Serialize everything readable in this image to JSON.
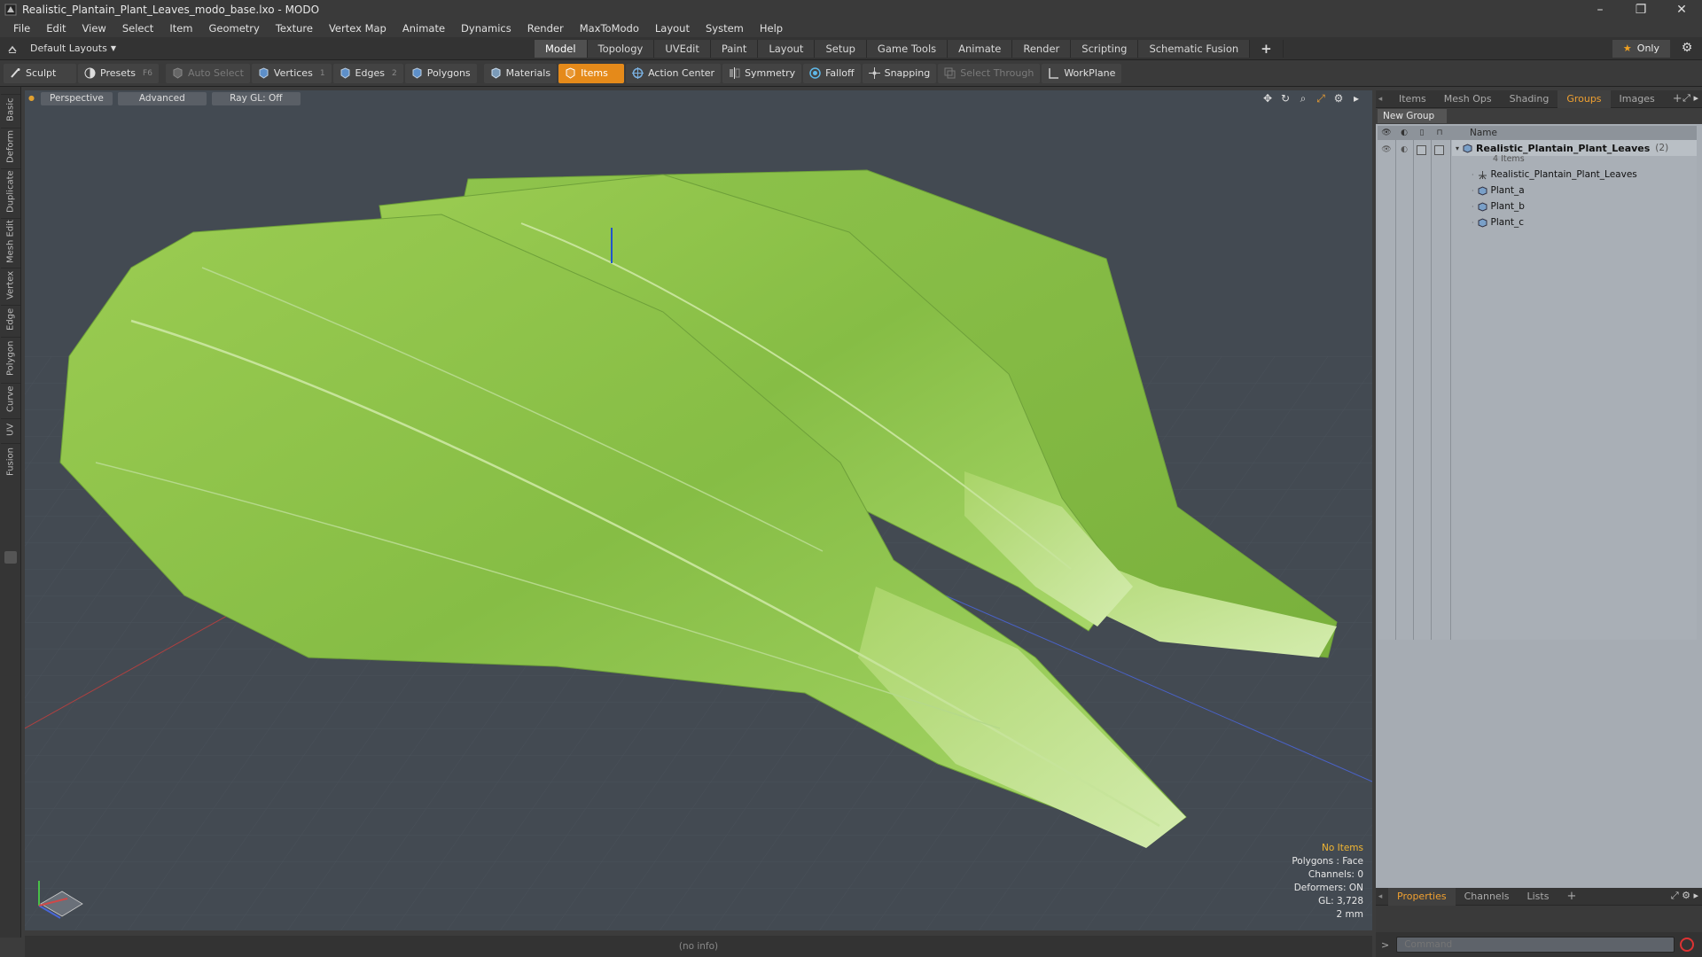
{
  "window": {
    "title": "Realistic_Plantain_Plant_Leaves_modo_base.lxo - MODO",
    "minimize": "–",
    "maximize": "❐",
    "close": "✕"
  },
  "menu": [
    "File",
    "Edit",
    "View",
    "Select",
    "Item",
    "Geometry",
    "Texture",
    "Vertex Map",
    "Animate",
    "Dynamics",
    "Render",
    "MaxToModo",
    "Layout",
    "System",
    "Help"
  ],
  "layoutbar": {
    "layouts_label": "Default Layouts",
    "tabs": [
      "Model",
      "Topology",
      "UVEdit",
      "Paint",
      "Layout",
      "Setup",
      "Game Tools",
      "Animate",
      "Render",
      "Scripting",
      "Schematic Fusion"
    ],
    "active_tab": "Model",
    "plus": "+",
    "only_label": "Only"
  },
  "toolbar": {
    "sculpt": "Sculpt",
    "presets": "Presets",
    "presets_key": "F6",
    "auto_select": "Auto Select",
    "vertices": "Vertices",
    "vertices_key": "1",
    "edges": "Edges",
    "edges_key": "2",
    "polygons": "Polygons",
    "materials": "Materials",
    "items": "Items",
    "action_center": "Action Center",
    "symmetry": "Symmetry",
    "falloff": "Falloff",
    "snapping": "Snapping",
    "select_through": "Select Through",
    "workplane": "WorkPlane"
  },
  "lefttabs": [
    "Basic",
    "Deform",
    "Duplicate",
    "Mesh Edit",
    "Vertex",
    "Edge",
    "Polygon",
    "Curve",
    "UV",
    "Fusion"
  ],
  "viewport": {
    "view_mode": "Perspective",
    "shading": "Advanced",
    "raygl": "Ray GL: Off",
    "stats": {
      "items": "No Items",
      "polygons": "Polygons : Face",
      "channels": "Channels: 0",
      "deformers": "Deformers: ON",
      "gl": "GL: 3,728",
      "scale": "2 mm"
    }
  },
  "infobar": "(no info)",
  "rightpanel": {
    "tabs": [
      "Items",
      "Mesh Ops",
      "Shading",
      "Groups",
      "Images"
    ],
    "active_tab": "Groups",
    "new_group": "New Group",
    "name_header": "Name",
    "group": {
      "name": "Realistic_Plantain_Plant_Leaves",
      "count": "(2)",
      "items_label": "4 Items",
      "children": [
        "Realistic_Plantain_Plant_Leaves",
        "Plant_a",
        "Plant_b",
        "Plant_c"
      ]
    },
    "bottom_tabs": [
      "Properties",
      "Channels",
      "Lists"
    ],
    "bottom_active": "Properties"
  },
  "command": {
    "prompt": ">",
    "placeholder": "Command"
  },
  "colors": {
    "accent": "#e58a1a",
    "viewport_bg": "#434a52",
    "leaf": "#8cc24a"
  }
}
